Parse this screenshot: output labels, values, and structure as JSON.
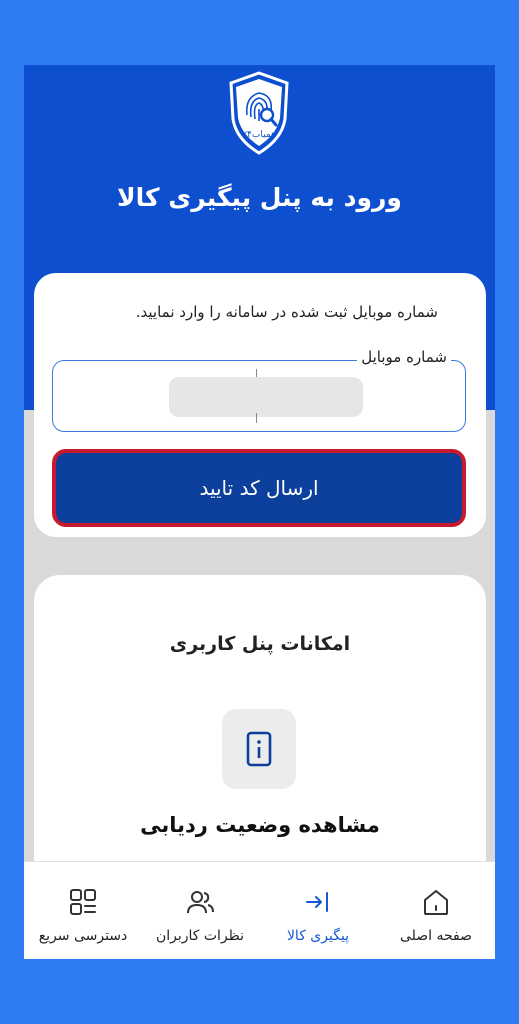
{
  "header": {
    "logo_text": "همیاب۲۴",
    "title": "ورود به پنل پیگیری کالا"
  },
  "login": {
    "instruction": "شماره موبایل ثبت شده در سامانه را وارد نمایید.",
    "mobile_label": "شماره موبایل",
    "mobile_value": "",
    "submit_label": "ارسال کد تایید"
  },
  "features": {
    "title": "امکانات پنل کاربری",
    "items": [
      {
        "label": "مشاهده وضعیت ردیابی",
        "icon": "phone-info-icon"
      }
    ]
  },
  "bottom_nav": {
    "active_color": "#1656d8",
    "items": [
      {
        "label": "صفحه اصلی",
        "icon": "home-icon"
      },
      {
        "label": "پیگیری کالا",
        "icon": "login-arrow-icon"
      },
      {
        "label": "نظرات کاربران",
        "icon": "users-icon"
      },
      {
        "label": "دسترسی سریع",
        "icon": "grid-menu-icon"
      }
    ]
  },
  "colors": {
    "background": "#2f7bf2",
    "hero": "#0d4fcf",
    "button": "#0d3f9d",
    "button_border": "#c8192f"
  }
}
